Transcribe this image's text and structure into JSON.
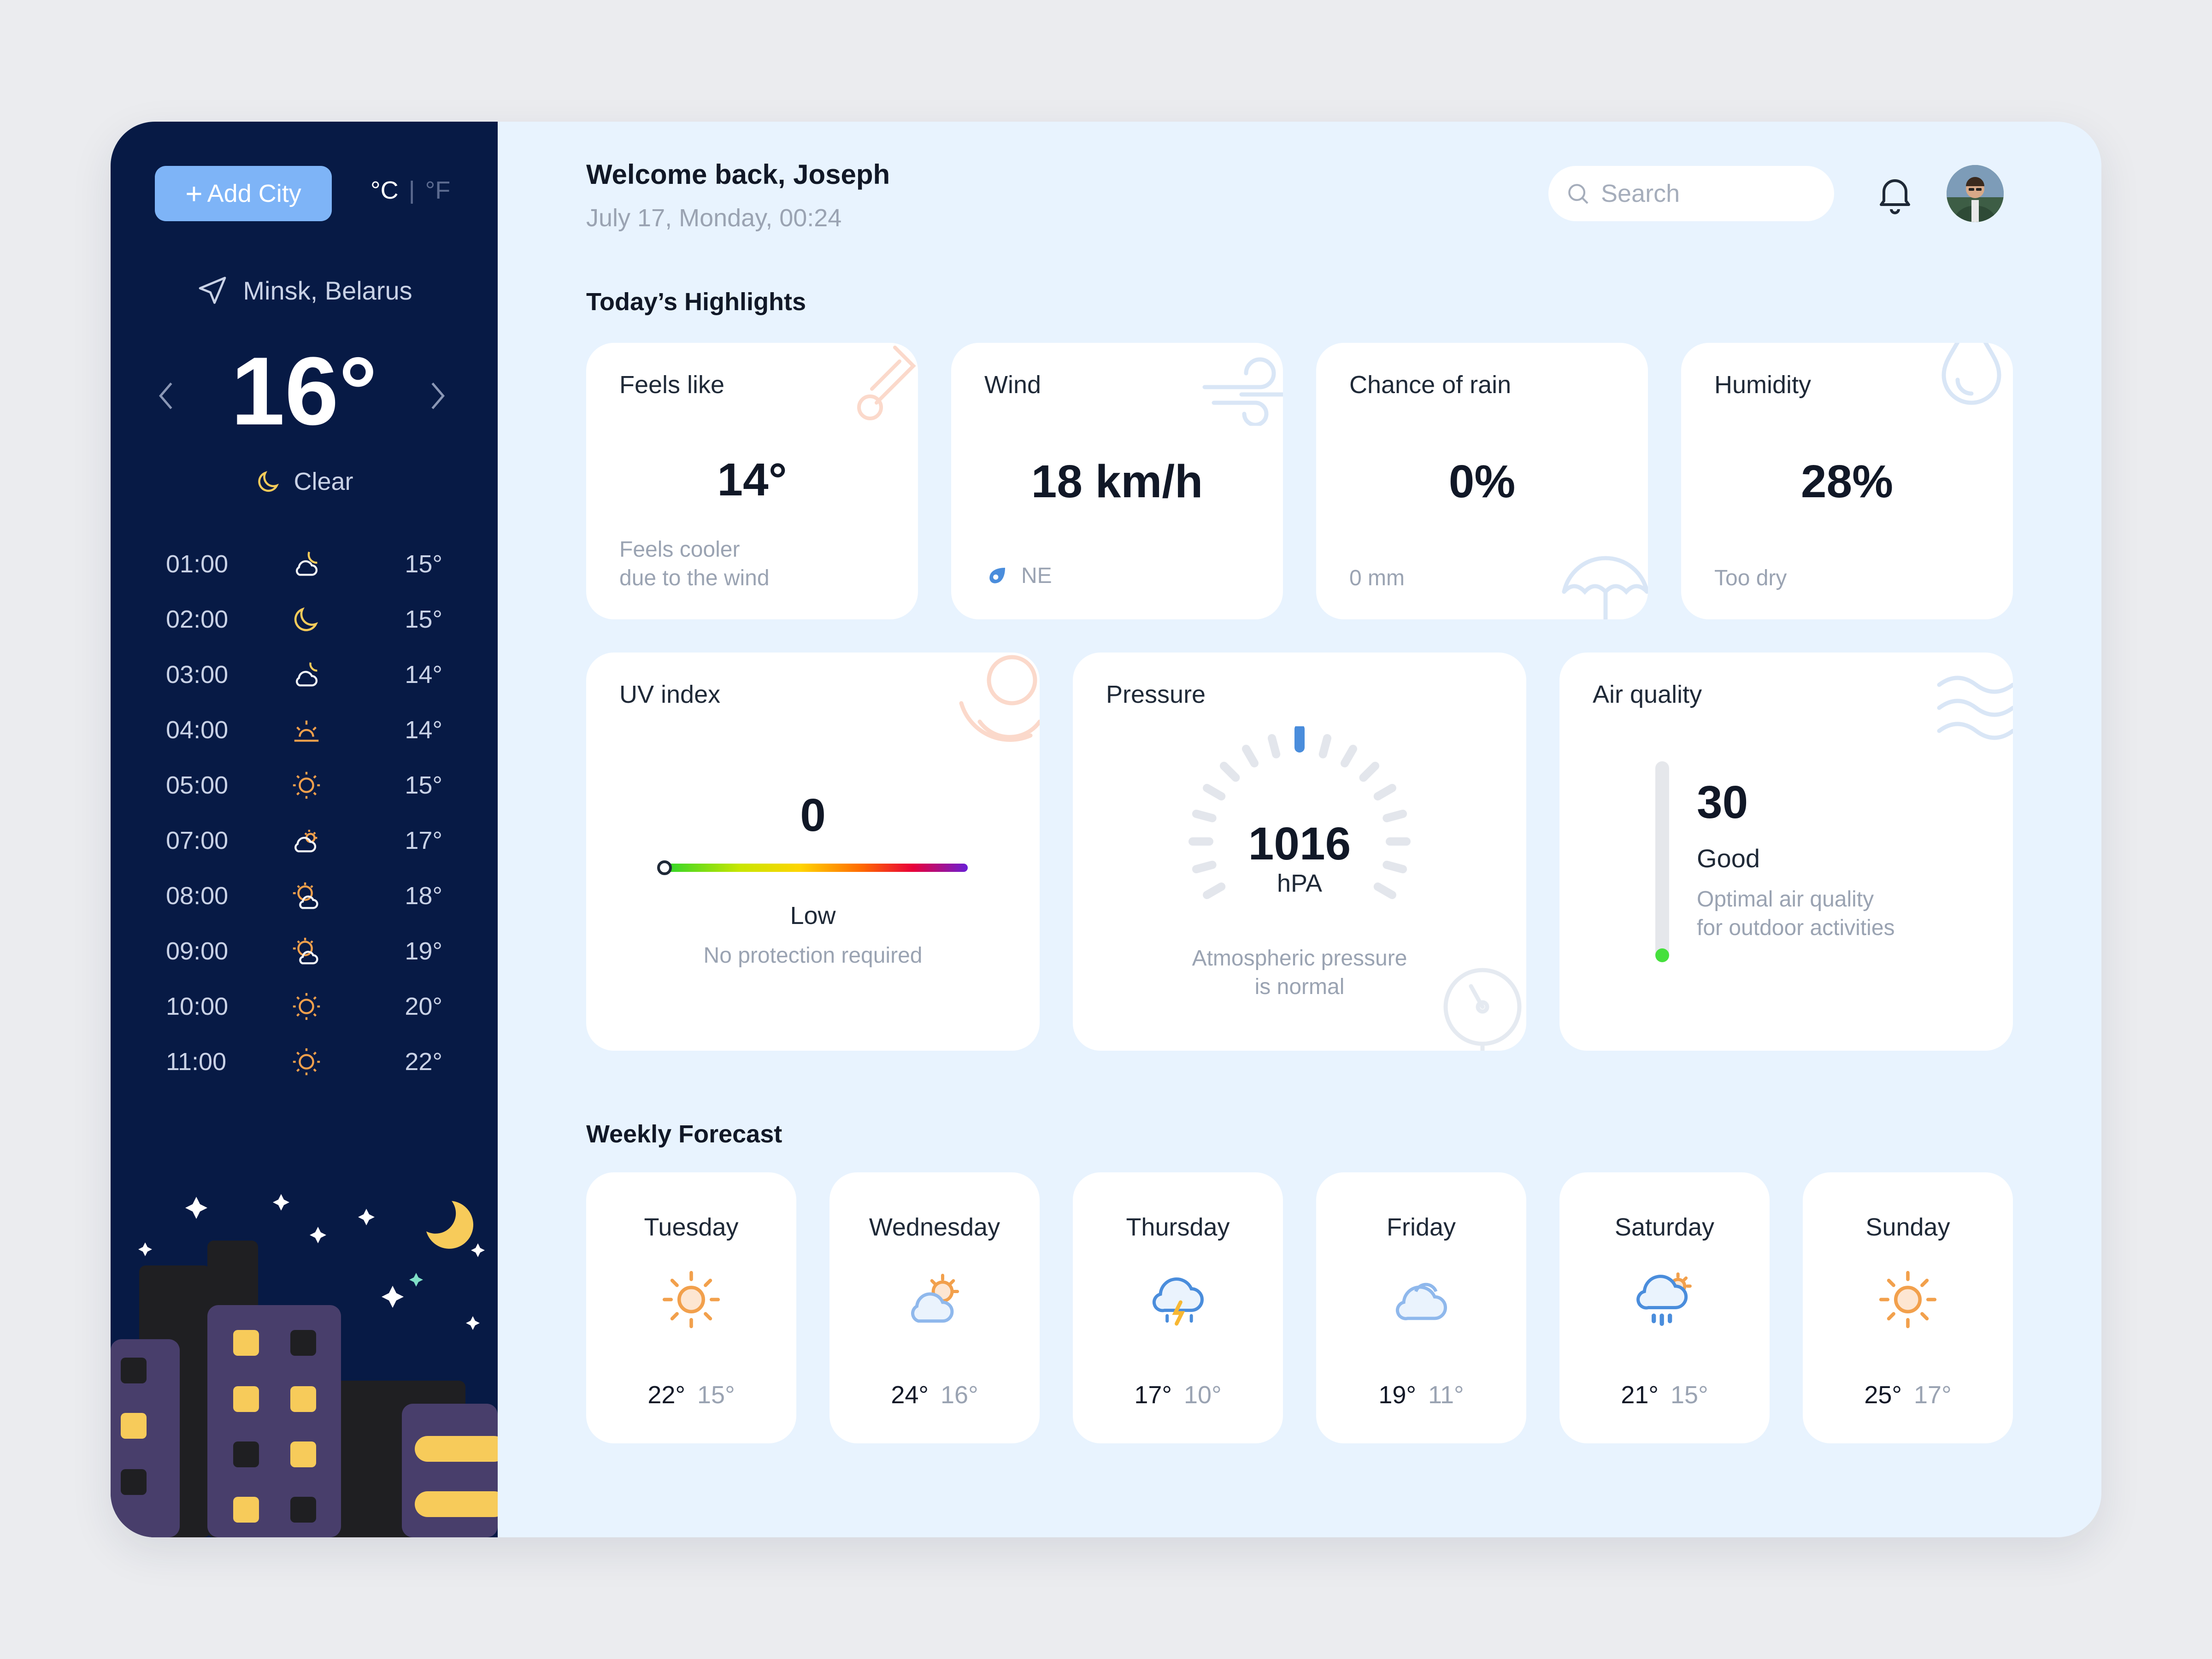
{
  "sidebar": {
    "add_city_label": "Add City",
    "unit_c": "°C",
    "unit_separator": "|",
    "unit_f": "°F",
    "location": "Minsk, Belarus",
    "current_temp": "16°",
    "condition": "Clear",
    "hourly": [
      {
        "time": "01:00",
        "icon": "moon-cloud-icon",
        "temp": "15°"
      },
      {
        "time": "02:00",
        "icon": "moon-icon",
        "temp": "15°"
      },
      {
        "time": "03:00",
        "icon": "moon-cloud-icon",
        "temp": "14°"
      },
      {
        "time": "04:00",
        "icon": "sunrise-icon",
        "temp": "14°"
      },
      {
        "time": "05:00",
        "icon": "sun-icon",
        "temp": "15°"
      },
      {
        "time": "07:00",
        "icon": "sun-cloud-icon",
        "temp": "17°"
      },
      {
        "time": "08:00",
        "icon": "sun-cloud-icon",
        "temp": "18°"
      },
      {
        "time": "09:00",
        "icon": "sun-cloud-icon",
        "temp": "19°"
      },
      {
        "time": "10:00",
        "icon": "sun-icon",
        "temp": "20°"
      },
      {
        "time": "11:00",
        "icon": "sun-icon",
        "temp": "22°"
      }
    ]
  },
  "header": {
    "welcome": "Welcome back, Joseph",
    "date": "July 17, Monday, 00:24",
    "search_placeholder": "Search"
  },
  "highlights": {
    "title": "Today’s Highlights",
    "feels_like": {
      "label": "Feels like",
      "value": "14°",
      "note_line1": "Feels cooler",
      "note_line2": "due to the wind"
    },
    "wind": {
      "label": "Wind",
      "value": "18 km/h",
      "direction": "NE"
    },
    "rain": {
      "label": "Chance of rain",
      "value": "0%",
      "amount": "0 mm"
    },
    "humidity": {
      "label": "Humidity",
      "value": "28%",
      "note": "Too dry"
    },
    "uv": {
      "label": "UV index",
      "value": "0",
      "level": "Low",
      "note": "No protection required",
      "fraction": 0
    },
    "pressure": {
      "label": "Pressure",
      "value": "1016",
      "unit": "hPA",
      "note_line1": "Atmospheric pressure",
      "note_line2": "is normal"
    },
    "air": {
      "label": "Air quality",
      "value": "30",
      "level": "Good",
      "note_line1": "Optimal air quality",
      "note_line2": "for outdoor activities",
      "fill_fraction": 0.05
    }
  },
  "weekly": {
    "title": "Weekly Forecast",
    "days": [
      {
        "day": "Tuesday",
        "icon": "sun-icon",
        "hi": "22°",
        "lo": "15°"
      },
      {
        "day": "Wednesday",
        "icon": "sun-cloud-icon",
        "hi": "24°",
        "lo": "16°"
      },
      {
        "day": "Thursday",
        "icon": "thunderstorm-icon",
        "hi": "17°",
        "lo": "10°"
      },
      {
        "day": "Friday",
        "icon": "cloud-icon",
        "hi": "19°",
        "lo": "11°"
      },
      {
        "day": "Saturday",
        "icon": "sun-rain-icon",
        "hi": "21°",
        "lo": "15°"
      },
      {
        "day": "Sunday",
        "icon": "sun-icon",
        "hi": "25°",
        "lo": "17°"
      }
    ]
  },
  "colors": {
    "sidebar_bg": "#071a45",
    "main_bg": "#e8f3fe",
    "accent_button": "#7eb4f7",
    "moon": "#f7cb5a",
    "sun": "#f2a04c",
    "cloud_outline": "#8fb8ec",
    "air_good": "#45e03c"
  }
}
